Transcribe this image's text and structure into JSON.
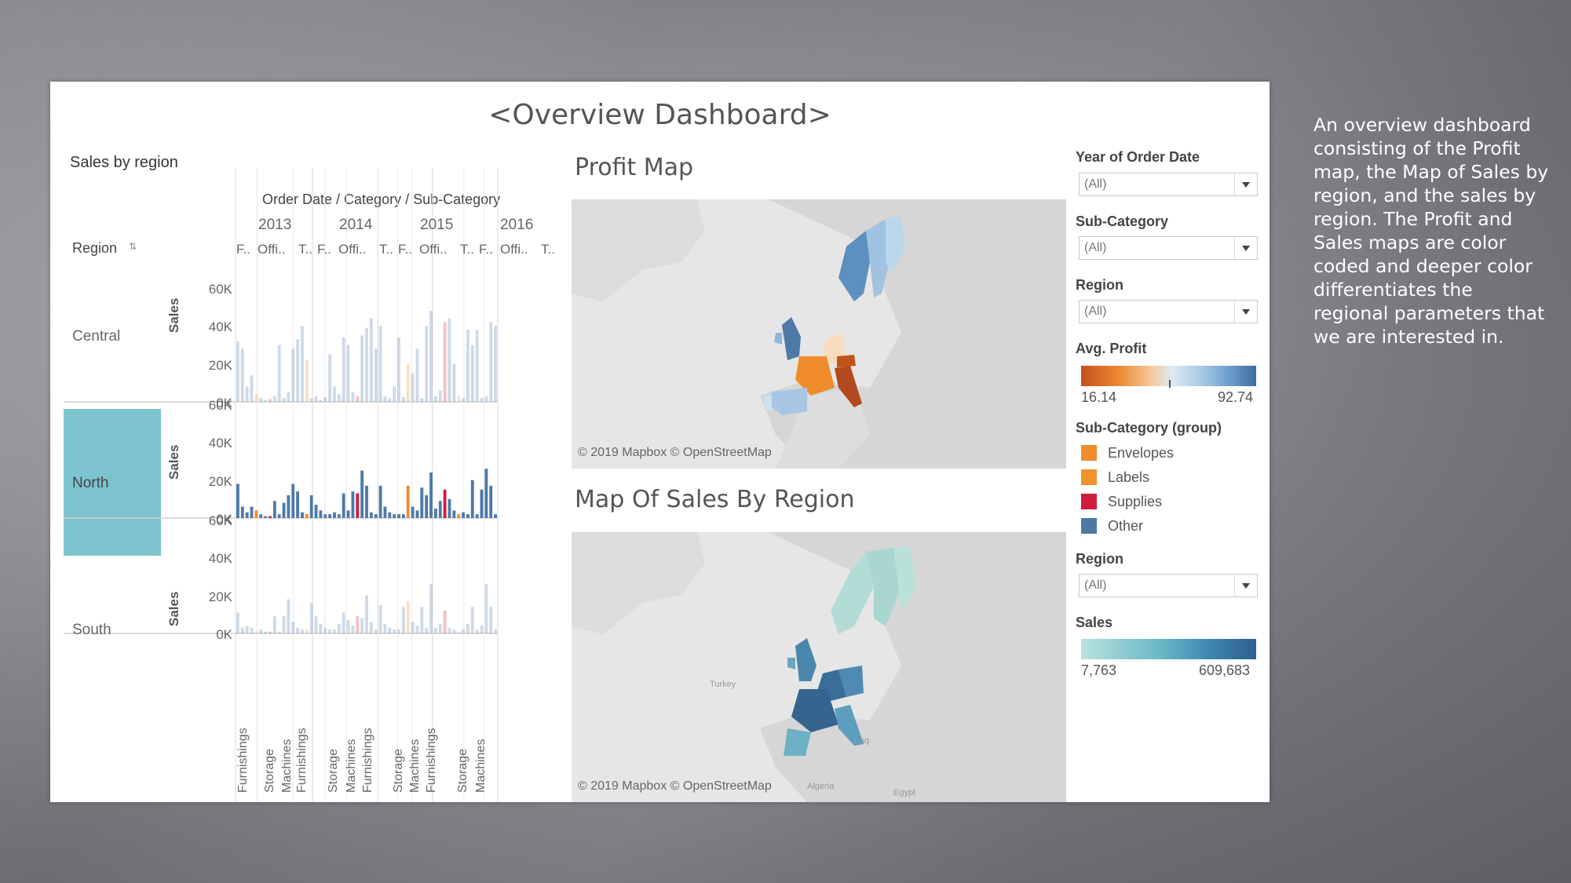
{
  "dashboard_title": "<Overview Dashboard>",
  "left_panel": {
    "title": "Sales by region",
    "column_header": "Order Date / Category / Sub-Category",
    "region_header": "Region",
    "years": [
      "2013",
      "2014",
      "2015",
      "2016"
    ],
    "sub_headers": [
      "F..",
      "Offi..",
      "T..",
      "F..",
      "Offi..",
      "T..",
      "F..",
      "Offi..",
      "T..",
      "F..",
      "Offi..",
      "T.."
    ],
    "measure_label": "Sales",
    "y_ticks": [
      "60K",
      "40K",
      "20K",
      "0K"
    ],
    "regions": [
      "Central",
      "North",
      "South"
    ],
    "bottom_labels": [
      "Furnishings",
      "Storage",
      "Machines",
      "Furnishings",
      "Storage",
      "Machines",
      "Furnishings",
      "Storage",
      "Machines",
      "Furnishings",
      "Storage",
      "Machines"
    ]
  },
  "chart_data": {
    "type": "bar",
    "title": "Sales by region",
    "xlabel": "Order Date / Category / Sub-Category",
    "ylabel": "Sales",
    "ylim": [
      0,
      60000
    ],
    "categories": [
      "2013",
      "2014",
      "2015",
      "2016"
    ],
    "series": [
      {
        "name": "Central",
        "values": [
          32000,
          28000,
          8000,
          14000,
          4000,
          2000,
          1000,
          1500,
          3000,
          30000,
          2000,
          5000,
          28000,
          33000,
          40000,
          22000,
          2000,
          3000,
          1000,
          2500,
          25000,
          8000,
          4000,
          34000,
          30000,
          5000,
          3000,
          35000,
          39000,
          44000,
          28000,
          40000,
          3000,
          2000,
          8000,
          34000,
          2500,
          20000,
          15000,
          28000,
          2000,
          40000,
          48000,
          3000,
          6000,
          42000,
          44000,
          20000,
          3000,
          2000,
          38000,
          30000,
          38000,
          2000,
          3000,
          42000,
          40000
        ]
      },
      {
        "name": "North",
        "values": [
          18000,
          6000,
          3000,
          6000,
          4000,
          2000,
          1000,
          1000,
          9000,
          2000,
          8000,
          12000,
          18000,
          14000,
          3000,
          2000,
          12000,
          7000,
          4000,
          2000,
          2000,
          3000,
          2000,
          13000,
          4000,
          14000,
          13000,
          25000,
          17000,
          3000,
          2000,
          17000,
          6000,
          3000,
          2000,
          2000,
          2000,
          17000,
          6000,
          4000,
          16000,
          12000,
          24000,
          5000,
          9000,
          15000,
          10000,
          4000,
          2000,
          3000,
          2000,
          20000,
          2000,
          15000,
          26000,
          17000,
          2000
        ]
      },
      {
        "name": "South",
        "values": [
          11000,
          3000,
          4000,
          3000,
          1000,
          2000,
          1000,
          1000,
          9000,
          1000,
          9000,
          18000,
          6000,
          3000,
          2000,
          2000,
          16000,
          9000,
          5000,
          3000,
          2000,
          2000,
          5000,
          11000,
          7000,
          4000,
          9000,
          8000,
          20000,
          6000,
          2000,
          15000,
          5000,
          3000,
          2000,
          2000,
          14000,
          17000,
          6000,
          4000,
          14000,
          3000,
          26000,
          3000,
          5000,
          12000,
          3000,
          2000,
          1000,
          2000,
          5000,
          14000,
          2000,
          4000,
          26000,
          14000,
          2000
        ]
      }
    ],
    "group_colors": {
      "Envelopes": "#ef8c2b",
      "Labels": "#f0932e",
      "Supplies": "#d01c3c",
      "Other": "#4e79a7"
    }
  },
  "profit_map": {
    "title": "Profit Map",
    "credit": "© 2019 Mapbox © OpenStreetMap"
  },
  "sales_map": {
    "title": "Map Of Sales By Region",
    "credit": "© 2019 Mapbox © OpenStreetMap",
    "place_labels": [
      "Turkey",
      "Iraq",
      "Algeria",
      "Egypt"
    ]
  },
  "filters": {
    "year": {
      "label": "Year of Order Date",
      "value": "(All)"
    },
    "subcategory": {
      "label": "Sub-Category",
      "value": "(All)"
    },
    "region": {
      "label": "Region",
      "value": "(All)"
    },
    "region2": {
      "label": "Region",
      "value": "(All)"
    }
  },
  "avg_profit_legend": {
    "label": "Avg. Profit",
    "min": "16.14",
    "max": "92.74"
  },
  "subcat_group_legend": {
    "label": "Sub-Category (group)",
    "items": [
      {
        "label": "Envelopes",
        "color": "#ef8c2b"
      },
      {
        "label": "Labels",
        "color": "#f0932e"
      },
      {
        "label": "Supplies",
        "color": "#d01c3c"
      },
      {
        "label": "Other",
        "color": "#4e79a7"
      }
    ]
  },
  "sales_legend": {
    "label": "Sales",
    "min": "7,763",
    "max": "609,683"
  },
  "notes": "An overview dashboard  consisting of the Profit map, the Map of Sales by region, and the sales by region. The Profit and Sales maps are color coded and deeper color differentiates the regional parameters that we are interested in."
}
